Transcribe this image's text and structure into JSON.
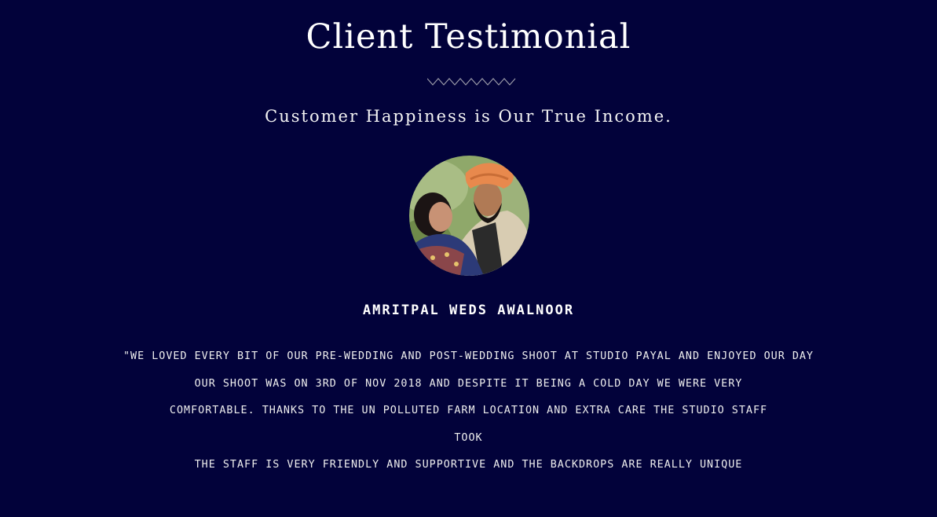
{
  "section": {
    "title": "Client Testimonial",
    "subtitle": "Customer Happiness is Our True Income."
  },
  "testimonial": {
    "client_name": "Amritpal Weds Awalnoor",
    "quote_lines": [
      "\"We loved every bit of our pre-wedding and post-wedding shoot at studio payal and enjoyed our day",
      "our shoot was on 3rd of nov 2018 and despite it being a cold day we were very",
      "comfortable. thanks to the un polluted farm location and extra care the studio staff",
      "took",
      "the staff is very friendly and supportive  and the backdrops are really unique"
    ]
  },
  "colors": {
    "background": "#02023a",
    "text": "#ffffff",
    "divider": "#9a9aa8"
  }
}
